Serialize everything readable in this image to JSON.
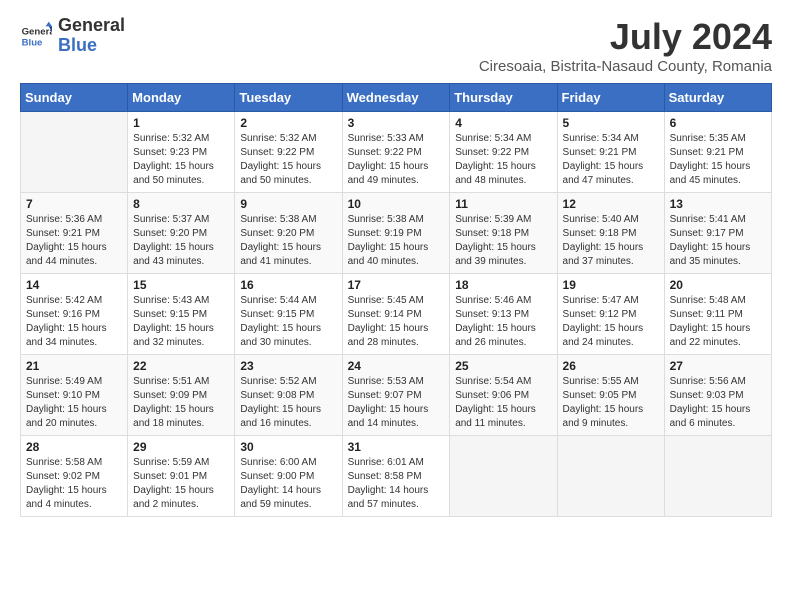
{
  "header": {
    "logo_general": "General",
    "logo_blue": "Blue",
    "month_title": "July 2024",
    "subtitle": "Ciresoaia, Bistrita-Nasaud County, Romania"
  },
  "days_of_week": [
    "Sunday",
    "Monday",
    "Tuesday",
    "Wednesday",
    "Thursday",
    "Friday",
    "Saturday"
  ],
  "weeks": [
    [
      {
        "day": "",
        "info": ""
      },
      {
        "day": "1",
        "info": "Sunrise: 5:32 AM\nSunset: 9:23 PM\nDaylight: 15 hours\nand 50 minutes."
      },
      {
        "day": "2",
        "info": "Sunrise: 5:32 AM\nSunset: 9:22 PM\nDaylight: 15 hours\nand 50 minutes."
      },
      {
        "day": "3",
        "info": "Sunrise: 5:33 AM\nSunset: 9:22 PM\nDaylight: 15 hours\nand 49 minutes."
      },
      {
        "day": "4",
        "info": "Sunrise: 5:34 AM\nSunset: 9:22 PM\nDaylight: 15 hours\nand 48 minutes."
      },
      {
        "day": "5",
        "info": "Sunrise: 5:34 AM\nSunset: 9:21 PM\nDaylight: 15 hours\nand 47 minutes."
      },
      {
        "day": "6",
        "info": "Sunrise: 5:35 AM\nSunset: 9:21 PM\nDaylight: 15 hours\nand 45 minutes."
      }
    ],
    [
      {
        "day": "7",
        "info": "Sunrise: 5:36 AM\nSunset: 9:21 PM\nDaylight: 15 hours\nand 44 minutes."
      },
      {
        "day": "8",
        "info": "Sunrise: 5:37 AM\nSunset: 9:20 PM\nDaylight: 15 hours\nand 43 minutes."
      },
      {
        "day": "9",
        "info": "Sunrise: 5:38 AM\nSunset: 9:20 PM\nDaylight: 15 hours\nand 41 minutes."
      },
      {
        "day": "10",
        "info": "Sunrise: 5:38 AM\nSunset: 9:19 PM\nDaylight: 15 hours\nand 40 minutes."
      },
      {
        "day": "11",
        "info": "Sunrise: 5:39 AM\nSunset: 9:18 PM\nDaylight: 15 hours\nand 39 minutes."
      },
      {
        "day": "12",
        "info": "Sunrise: 5:40 AM\nSunset: 9:18 PM\nDaylight: 15 hours\nand 37 minutes."
      },
      {
        "day": "13",
        "info": "Sunrise: 5:41 AM\nSunset: 9:17 PM\nDaylight: 15 hours\nand 35 minutes."
      }
    ],
    [
      {
        "day": "14",
        "info": "Sunrise: 5:42 AM\nSunset: 9:16 PM\nDaylight: 15 hours\nand 34 minutes."
      },
      {
        "day": "15",
        "info": "Sunrise: 5:43 AM\nSunset: 9:15 PM\nDaylight: 15 hours\nand 32 minutes."
      },
      {
        "day": "16",
        "info": "Sunrise: 5:44 AM\nSunset: 9:15 PM\nDaylight: 15 hours\nand 30 minutes."
      },
      {
        "day": "17",
        "info": "Sunrise: 5:45 AM\nSunset: 9:14 PM\nDaylight: 15 hours\nand 28 minutes."
      },
      {
        "day": "18",
        "info": "Sunrise: 5:46 AM\nSunset: 9:13 PM\nDaylight: 15 hours\nand 26 minutes."
      },
      {
        "day": "19",
        "info": "Sunrise: 5:47 AM\nSunset: 9:12 PM\nDaylight: 15 hours\nand 24 minutes."
      },
      {
        "day": "20",
        "info": "Sunrise: 5:48 AM\nSunset: 9:11 PM\nDaylight: 15 hours\nand 22 minutes."
      }
    ],
    [
      {
        "day": "21",
        "info": "Sunrise: 5:49 AM\nSunset: 9:10 PM\nDaylight: 15 hours\nand 20 minutes."
      },
      {
        "day": "22",
        "info": "Sunrise: 5:51 AM\nSunset: 9:09 PM\nDaylight: 15 hours\nand 18 minutes."
      },
      {
        "day": "23",
        "info": "Sunrise: 5:52 AM\nSunset: 9:08 PM\nDaylight: 15 hours\nand 16 minutes."
      },
      {
        "day": "24",
        "info": "Sunrise: 5:53 AM\nSunset: 9:07 PM\nDaylight: 15 hours\nand 14 minutes."
      },
      {
        "day": "25",
        "info": "Sunrise: 5:54 AM\nSunset: 9:06 PM\nDaylight: 15 hours\nand 11 minutes."
      },
      {
        "day": "26",
        "info": "Sunrise: 5:55 AM\nSunset: 9:05 PM\nDaylight: 15 hours\nand 9 minutes."
      },
      {
        "day": "27",
        "info": "Sunrise: 5:56 AM\nSunset: 9:03 PM\nDaylight: 15 hours\nand 6 minutes."
      }
    ],
    [
      {
        "day": "28",
        "info": "Sunrise: 5:58 AM\nSunset: 9:02 PM\nDaylight: 15 hours\nand 4 minutes."
      },
      {
        "day": "29",
        "info": "Sunrise: 5:59 AM\nSunset: 9:01 PM\nDaylight: 15 hours\nand 2 minutes."
      },
      {
        "day": "30",
        "info": "Sunrise: 6:00 AM\nSunset: 9:00 PM\nDaylight: 14 hours\nand 59 minutes."
      },
      {
        "day": "31",
        "info": "Sunrise: 6:01 AM\nSunset: 8:58 PM\nDaylight: 14 hours\nand 57 minutes."
      },
      {
        "day": "",
        "info": ""
      },
      {
        "day": "",
        "info": ""
      },
      {
        "day": "",
        "info": ""
      }
    ]
  ]
}
